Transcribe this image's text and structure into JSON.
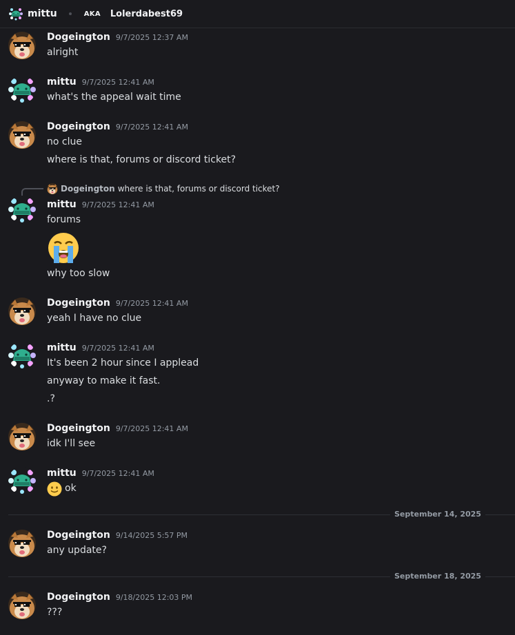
{
  "header": {
    "name": "mittu",
    "aka_label": "AKA",
    "alias": "Lolerdabest69"
  },
  "messages": [
    {
      "author": "Dogeington",
      "timestamp": "9/7/2025 12:37 AM",
      "lines": [
        "alright"
      ]
    },
    {
      "author": "mittu",
      "timestamp": "9/7/2025 12:41 AM",
      "lines": [
        "what's the appeal wait time"
      ]
    },
    {
      "author": "Dogeington",
      "timestamp": "9/7/2025 12:41 AM",
      "lines": [
        "no clue",
        "where is that, forums or discord ticket?"
      ]
    },
    {
      "author": "mittu",
      "timestamp": "9/7/2025 12:41 AM",
      "reply": {
        "author": "Dogeington",
        "text": "where is that, forums or discord ticket?"
      },
      "lines": [
        "forums",
        "why too slow"
      ],
      "emoji": "loudly-crying-face"
    },
    {
      "author": "Dogeington",
      "timestamp": "9/7/2025 12:41 AM",
      "lines": [
        "yeah I have no clue"
      ]
    },
    {
      "author": "mittu",
      "timestamp": "9/7/2025 12:41 AM",
      "lines": [
        "It's been 2 hour since I applead",
        "anyway to make it fast.",
        ".?"
      ]
    },
    {
      "author": "Dogeington",
      "timestamp": "9/7/2025 12:41 AM",
      "lines": [
        "idk I'll see"
      ]
    },
    {
      "author": "mittu",
      "timestamp": "9/7/2025 12:41 AM",
      "lines": [
        "ok"
      ],
      "emoji": "slightly-smiling-face"
    },
    {
      "author": "Dogeington",
      "timestamp": "9/14/2025 5:57 PM",
      "lines": [
        "any update?"
      ]
    },
    {
      "author": "Dogeington",
      "timestamp": "9/18/2025 12:03 PM",
      "lines": [
        "???"
      ]
    }
  ],
  "dividers": [
    "September 14, 2025",
    "September 18, 2025"
  ],
  "colors": {
    "background": "#1a1a1e",
    "username": "#f2f3f5",
    "timestamp": "#949ba4",
    "text": "#dbdee1"
  }
}
